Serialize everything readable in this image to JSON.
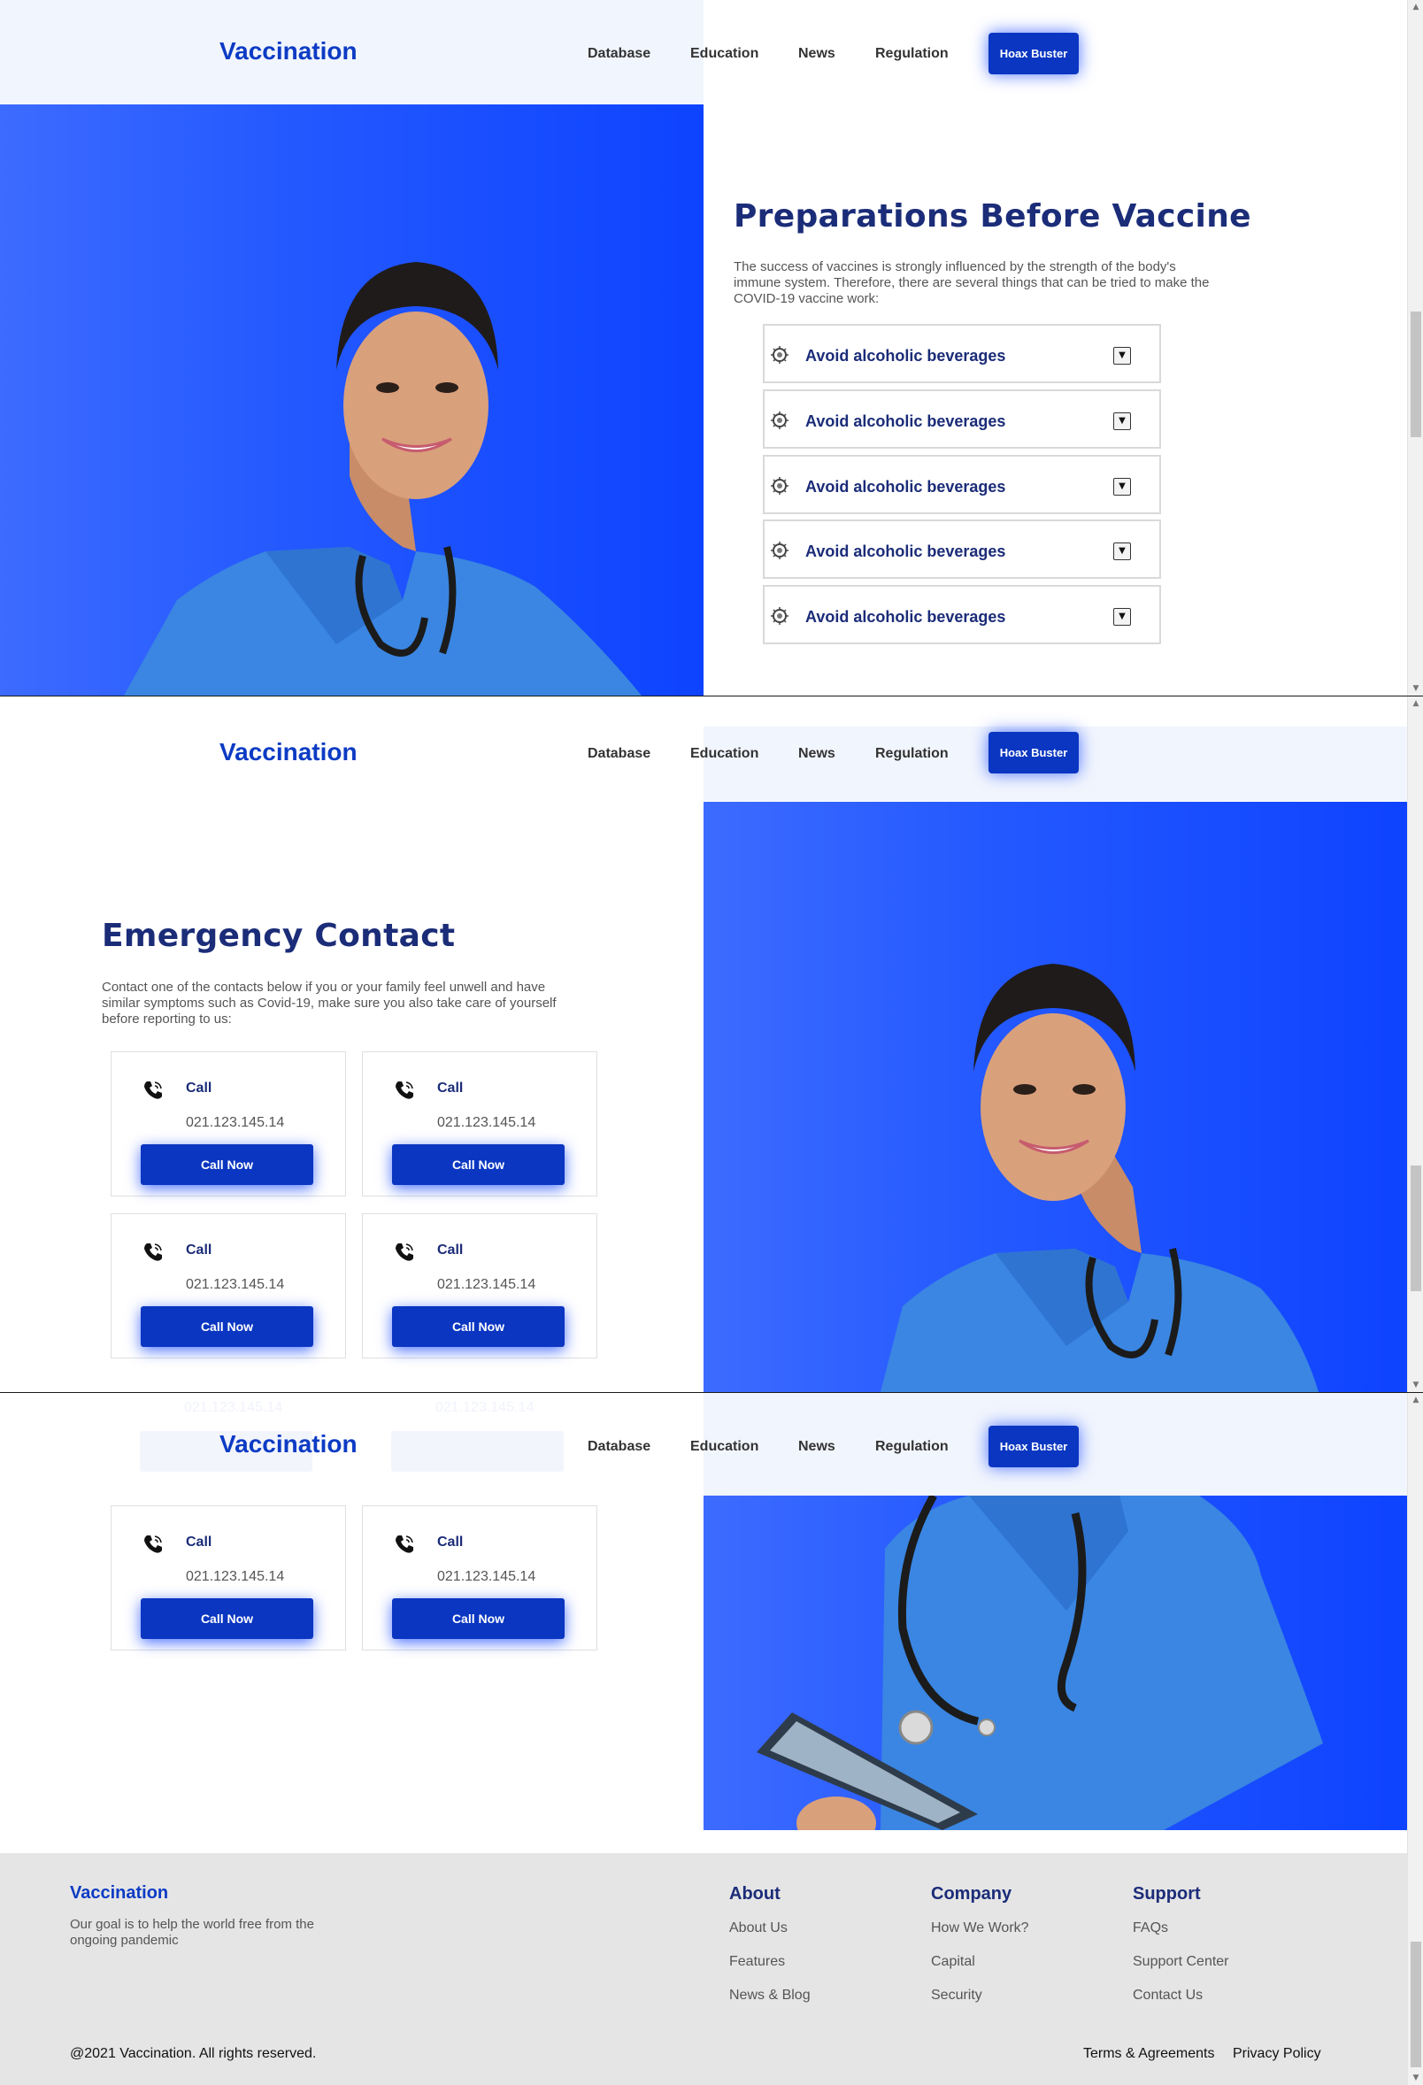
{
  "header": {
    "brand": "Vaccination",
    "nav": [
      "Database",
      "Education",
      "News",
      "Regulation"
    ],
    "cta": "Hoax Buster"
  },
  "preparations": {
    "title": "Preparations Before Vaccine",
    "intro_lines": [
      "The success of vaccines is strongly influenced by the strength of the body's",
      "immune system. Therefore, there are several things that can be tried to make the",
      "COVID-19 vaccine work:"
    ],
    "items": [
      "Avoid alcoholic beverages",
      "Avoid alcoholic beverages",
      "Avoid alcoholic beverages",
      "Avoid alcoholic beverages",
      "Avoid alcoholic beverages"
    ]
  },
  "emergency": {
    "title": "Emergency Contact",
    "intro_lines": [
      "Contact one of the contacts below if you or your family feel unwell and have",
      "similar symptoms such as Covid-19, make sure you also take care of yourself",
      "before reporting to us:"
    ],
    "card_title": "Call",
    "card_number": "021.123.145.14",
    "card_button": "Call Now"
  },
  "footer": {
    "brand": "Vaccination",
    "description": "Our goal is to help the world free from the ongoing pandemic",
    "about_title": "About",
    "about_links": [
      "About Us",
      "Features",
      "News & Blog"
    ],
    "company_title": "Company",
    "company_links": [
      "How We Work?",
      "Capital",
      "Security"
    ],
    "support_title": "Support",
    "support_links": [
      "FAQs",
      "Support Center",
      "Contact Us"
    ],
    "copyright": "@2021 Vaccination. All rights reserved.",
    "terms": "Terms & Agreements",
    "privacy": "Privacy Policy"
  },
  "colors": {
    "brand_blue": "#0c3bc4",
    "button_blue": "#0a36c1",
    "heading_navy": "#1b2c78",
    "hero_blue": "#1e50ff",
    "footer_bg": "#e5e5e5"
  }
}
